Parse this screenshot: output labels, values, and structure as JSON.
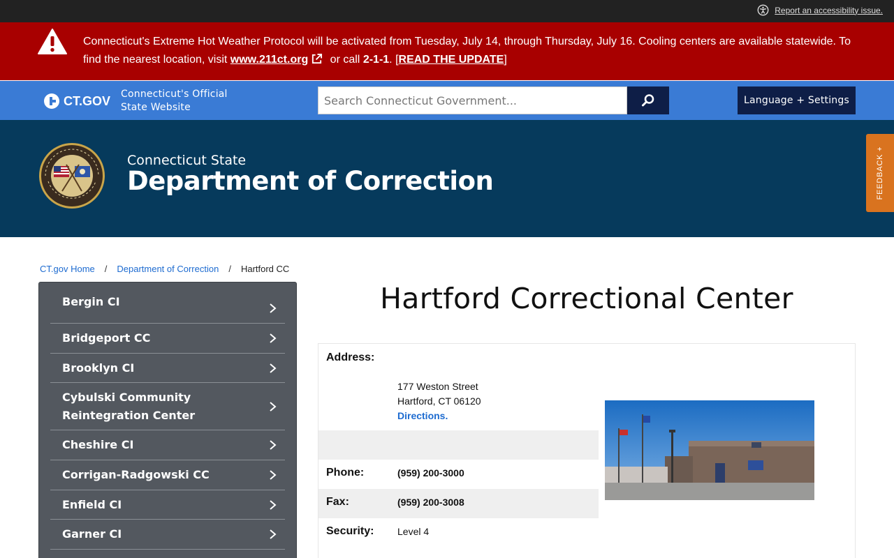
{
  "utility": {
    "accessibility_link": "Report an accessibility issue."
  },
  "alert": {
    "text_before": "Connecticut's Extreme Hot Weather Protocol will be activated from Tuesday, July 14, through Thursday, July 16. Cooling centers are available statewide. To find the nearest location, visit ",
    "link_211": "www.211ct.org",
    "text_call": " or call ",
    "phone": "2-1-1",
    "text_after_phone": ". [",
    "read_update": "READ THE UPDATE",
    "text_close": "]",
    "icon": "warning-triangle-icon",
    "color": "#a80000"
  },
  "ctgov": {
    "logo_text": "CT.GOV",
    "tagline_line1": "Connecticut's Official",
    "tagline_line2": "State Website",
    "search_placeholder": "Search Connecticut Government...",
    "language_button": "Language + Settings",
    "color": "#3a7bd5"
  },
  "agency": {
    "subtitle": "Connecticut State",
    "title": "Department of Correction",
    "color": "#063a5c"
  },
  "feedback": {
    "label": "FEEDBACK +"
  },
  "breadcrumb": {
    "home": "CT.gov Home",
    "department": "Department of Correction",
    "current": "Hartford CC"
  },
  "sidebar": {
    "items": [
      {
        "label": "Bergin CI"
      },
      {
        "label": "Bridgeport CC"
      },
      {
        "label": "Brooklyn CI"
      },
      {
        "label": "Cybulski Community Reintegration Center"
      },
      {
        "label": "Cheshire CI"
      },
      {
        "label": "Corrigan-Radgowski CC"
      },
      {
        "label": "Enfield CI"
      },
      {
        "label": "Garner CI"
      },
      {
        "label": ""
      }
    ]
  },
  "facility": {
    "title": "Hartford Correctional Center",
    "address_label": "Address:",
    "address_line1": "177 Weston Street",
    "address_line2": "Hartford, CT 06120",
    "directions": "Directions.",
    "phone_label": "Phone:",
    "phone": "(959) 200-3000",
    "fax_label": "Fax:",
    "fax": "(959) 200-3008",
    "security_label": "Security:",
    "security": "Level 4"
  }
}
